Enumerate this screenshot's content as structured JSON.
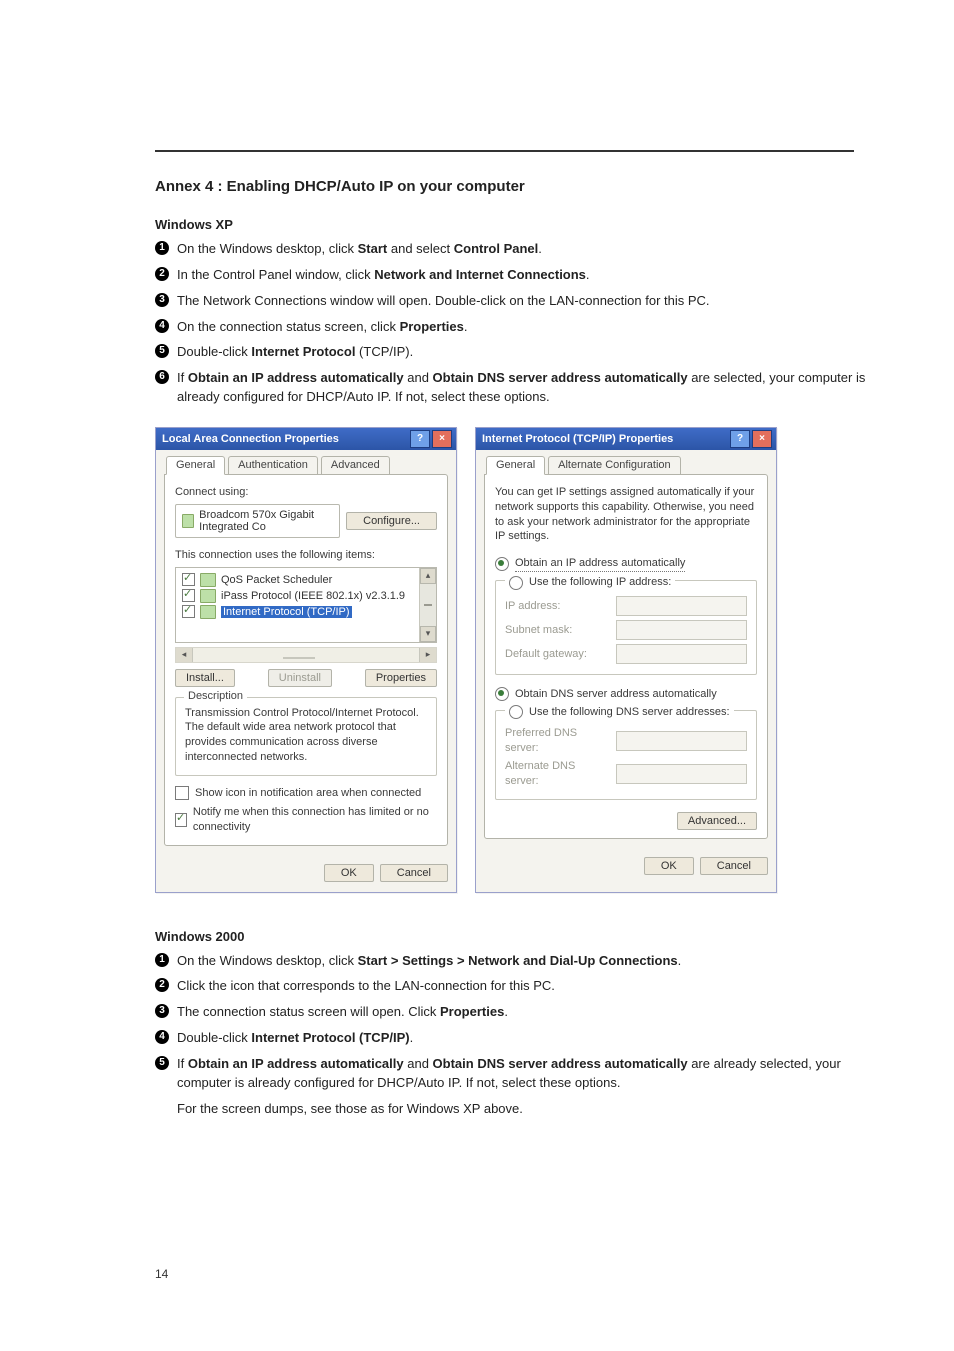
{
  "page_number": "14",
  "heading": "Annex 4 : Enabling DHCP/Auto IP on your computer",
  "xp": {
    "title": "Windows XP",
    "steps": [
      "On the Windows desktop, click <b>Start</b> and select <b>Control Panel</b>.",
      "In the Control Panel window, click <b>Network and Internet Connections</b>.",
      "The Network Connections window will open. Double-click on the LAN-connection for this PC.",
      "On the connection status screen, click <b>Properties</b>.",
      "Double-click <b>Internet Protocol</b> (TCP/IP).",
      "If <b>Obtain an IP address automatically</b> and <b>Obtain DNS server address automatically</b> are selected, your computer is already configured for DHCP/Auto IP. If not, select these options."
    ]
  },
  "w2k": {
    "title": "Windows 2000",
    "steps": [
      "On the Windows desktop, click <b>Start > Settings > Network and Dial-Up Connections</b>.",
      "Click the icon that corresponds to the LAN-connection for this PC.",
      "The connection status screen will open. Click <b>Properties</b>.",
      "Double-click <b>Internet Protocol (TCP/IP)</b>.",
      "If <b>Obtain an IP address automatically</b> and <b>Obtain DNS server address automatically</b> are already selected, your computer is already configured for DHCP/Auto IP. If not, select these options."
    ],
    "note": "For the screen dumps, see those as for Windows XP above."
  },
  "dlg_left": {
    "title": "Local Area Connection Properties",
    "tabs": [
      "General",
      "Authentication",
      "Advanced"
    ],
    "active_tab": 0,
    "connect_using_label": "Connect using:",
    "adapter": "Broadcom 570x Gigabit Integrated Co",
    "configure_btn": "Configure...",
    "items_label": "This connection uses the following items:",
    "items": [
      {
        "label": "QoS Packet Scheduler",
        "selected": false
      },
      {
        "label": "iPass Protocol (IEEE 802.1x) v2.3.1.9",
        "selected": false
      },
      {
        "label": "Internet Protocol (TCP/IP)",
        "selected": true
      }
    ],
    "install_btn": "Install...",
    "uninstall_btn": "Uninstall",
    "properties_btn": "Properties",
    "desc_title": "Description",
    "desc_text": "Transmission Control Protocol/Internet Protocol. The default wide area network protocol that provides communication across diverse interconnected networks.",
    "chk1": "Show icon in notification area when connected",
    "chk2": "Notify me when this connection has limited or no connectivity",
    "ok": "OK",
    "cancel": "Cancel"
  },
  "dlg_right": {
    "title": "Internet Protocol (TCP/IP) Properties",
    "tabs": [
      "General",
      "Alternate Configuration"
    ],
    "active_tab": 0,
    "intro": "You can get IP settings assigned automatically if your network supports this capability. Otherwise, you need to ask your network administrator for the appropriate IP settings.",
    "radio_auto_ip": "Obtain an IP address automatically",
    "radio_static_ip": "Use the following IP address:",
    "ip_label": "IP address:",
    "mask_label": "Subnet mask:",
    "gw_label": "Default gateway:",
    "radio_auto_dns": "Obtain DNS server address automatically",
    "radio_static_dns": "Use the following DNS server addresses:",
    "pdns_label": "Preferred DNS server:",
    "adns_label": "Alternate DNS server:",
    "advanced_btn": "Advanced...",
    "ok": "OK",
    "cancel": "Cancel"
  }
}
